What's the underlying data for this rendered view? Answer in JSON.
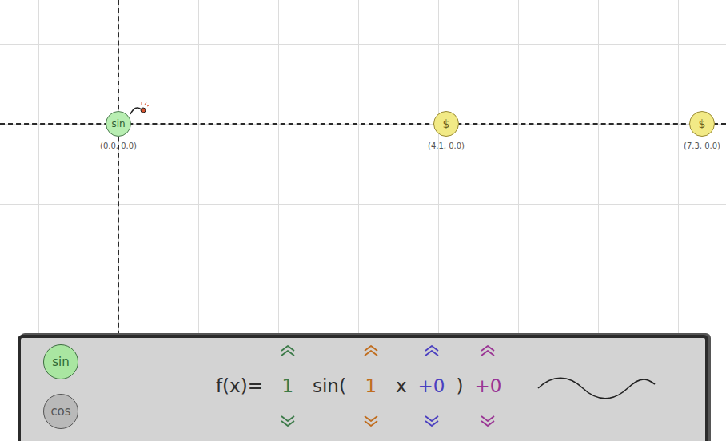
{
  "tokens": [
    {
      "kind": "player",
      "text": "sin",
      "label": "(0.0, 0.0)",
      "x": 0,
      "y": 0
    },
    {
      "kind": "coin",
      "text": "$",
      "label": "(4.1, 0.0)",
      "x": 4.1,
      "y": 0
    },
    {
      "kind": "coin",
      "text": "$",
      "label": "(7.3, 0.0)",
      "x": 7.3,
      "y": 0
    }
  ],
  "panel": {
    "functions": [
      {
        "label": "sin",
        "selected": true
      },
      {
        "label": "cos",
        "selected": false
      }
    ],
    "formula": [
      {
        "kind": "text",
        "text": "f(x)="
      },
      {
        "kind": "param",
        "text": "1",
        "color": "#3b7a48"
      },
      {
        "kind": "text",
        "text": "sin("
      },
      {
        "kind": "param",
        "text": "1",
        "color": "#c06d1e"
      },
      {
        "kind": "text",
        "text": "x"
      },
      {
        "kind": "param",
        "text": "+0",
        "color": "#4a3fc0"
      },
      {
        "kind": "text",
        "text": ")"
      },
      {
        "kind": "param",
        "text": "+0",
        "color": "#9a3494"
      }
    ]
  }
}
